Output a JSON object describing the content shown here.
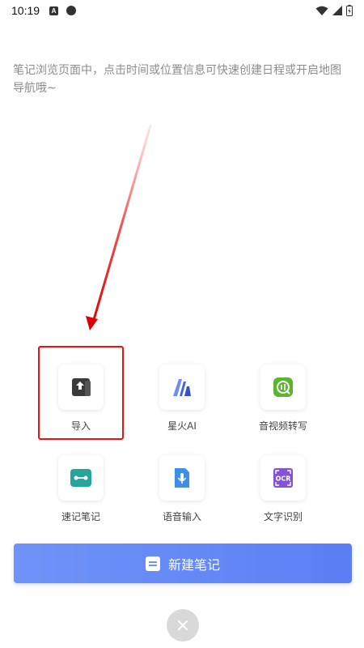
{
  "status_bar": {
    "time": "10:19"
  },
  "hint": {
    "text": "笔记浏览页面中，点击时间或位置信息可快速创建日程或开启地图导航哦~"
  },
  "grid": {
    "items": [
      {
        "label": "导入",
        "icon": "import-icon",
        "color": "#3a3a3a"
      },
      {
        "label": "星火AI",
        "icon": "spark-ai-icon",
        "color": "#3f63e6"
      },
      {
        "label": "音视频转写",
        "icon": "audio-video-transcribe-icon",
        "color": "#5cb531"
      },
      {
        "label": "速记笔记",
        "icon": "shorthand-note-icon",
        "color": "#26a69a"
      },
      {
        "label": "语音输入",
        "icon": "voice-input-icon",
        "color": "#3d8fe8"
      },
      {
        "label": "文字识别",
        "icon": "ocr-icon",
        "color": "#8354d6",
        "badge": "OCR"
      }
    ]
  },
  "new_note": {
    "label": "新建笔记"
  },
  "colors": {
    "accent": "#6f93f8",
    "highlight": "#ee1111"
  }
}
